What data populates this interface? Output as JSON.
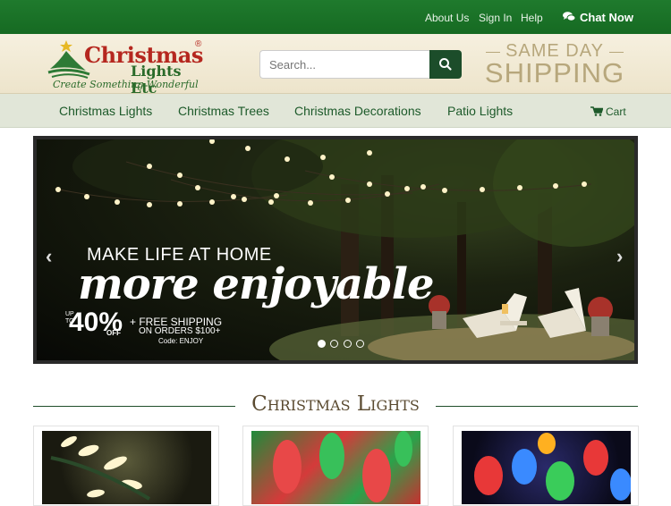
{
  "topbar": {
    "about": "About Us",
    "signin": "Sign In",
    "help": "Help",
    "chat": "Chat Now"
  },
  "logo": {
    "brand_line1": "Christmas",
    "registered": "®",
    "brand_line2": "Lights Etc",
    "tagline": "Create Something Wonderful"
  },
  "search": {
    "placeholder": "Search...",
    "button_icon": "search-icon"
  },
  "promo": {
    "line1": "SAME DAY",
    "line2": "SHIPPING"
  },
  "nav": {
    "items": [
      {
        "label": "Christmas Lights"
      },
      {
        "label": "Christmas Trees"
      },
      {
        "label": "Christmas Decorations"
      },
      {
        "label": "Patio Lights"
      }
    ],
    "cart": "Cart"
  },
  "hero": {
    "headline": "MAKE LIFE AT HOME",
    "script": "more enjoyable",
    "up_to": "UP\nTO",
    "discount": "40%",
    "off": "OFF",
    "free_shipping": "+ FREE SHIPPING",
    "orders_over": "ON ORDERS $100+",
    "code": "Code: ENJOY",
    "slide_count": 4,
    "active_slide": 1
  },
  "section": {
    "title": "Christmas Lights"
  },
  "colors": {
    "topbar_green": "#1f7a2d",
    "header_cream": "#f2ead4",
    "nav_bg": "#e1e6d8",
    "nav_text": "#1d5a2a",
    "logo_red": "#b5271f",
    "search_button": "#1c4d2a",
    "promo_tan": "#b7a77c",
    "section_title": "#5a4a30"
  }
}
